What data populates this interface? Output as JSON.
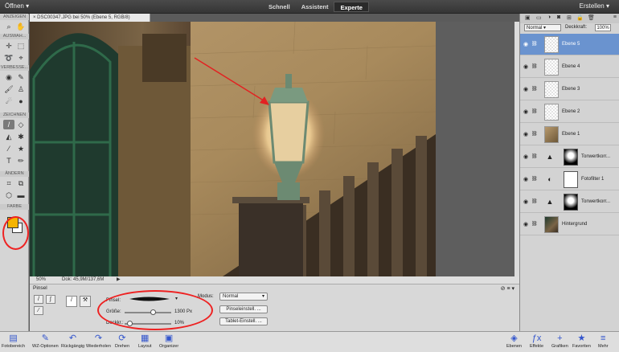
{
  "topbar": {
    "open_label": "Öffnen",
    "create_label": "Erstellen",
    "modes": [
      "Schnell",
      "Assistent",
      "Experte"
    ]
  },
  "toolbar": {
    "sections": [
      "ANZEIGEN",
      "AUSWAH...",
      "VERBESSE...",
      "ZEICHNEN",
      "ÄNDERN",
      "FARBE"
    ]
  },
  "document": {
    "tab_label": "DSC00347.JPG bei 50% (Ebene 5, RGB/8)",
    "zoom": "50%",
    "doc_size": "Dok: 45,9M/137,6M"
  },
  "options": {
    "title": "Pinsel",
    "brush_label": "Pinsel:",
    "size_label": "Größe:",
    "size_value": "1300 Px",
    "opacity_label": "Deckkr.:",
    "opacity_value": "10%",
    "mode_label": "Modus:",
    "mode_value": "Normal",
    "brush_settings_label": "Pinseleinstell. ...",
    "tablet_settings_label": "Tablet-Einstell. ...",
    "size_fraction": 0.6,
    "opacity_fraction": 0.1
  },
  "layers_panel": {
    "blend_mode": "Normal",
    "opacity_label": "Deckkraft:",
    "opacity_value": "100%",
    "layers": [
      {
        "name": "Ebene 5",
        "type": "empty",
        "selected": true
      },
      {
        "name": "Ebene 4",
        "type": "empty"
      },
      {
        "name": "Ebene 3",
        "type": "empty"
      },
      {
        "name": "Ebene 2",
        "type": "empty"
      },
      {
        "name": "Ebene 1",
        "type": "photo"
      },
      {
        "name": "Tonwertkorr...",
        "type": "adjust"
      },
      {
        "name": "Fotofilter 1",
        "type": "filter"
      },
      {
        "name": "Tonwertkorr...",
        "type": "adjust"
      },
      {
        "name": "Hintergrund",
        "type": "background"
      }
    ]
  },
  "bottombar": {
    "left": [
      "Fotobereich",
      "WZ-Optionen",
      "Rückgängig",
      "Wiederholen",
      "Drehen",
      "Layout",
      "Organizer"
    ],
    "right": [
      "Ebenen",
      "Effekte",
      "Grafiken",
      "Favoriten",
      "Mehr"
    ]
  },
  "colors": {
    "foreground": "#f5b400",
    "background": "#ffffff",
    "accent": "#6a93cf",
    "annotation": "#e22222"
  }
}
